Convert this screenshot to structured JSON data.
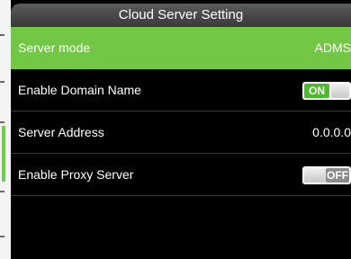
{
  "window": {
    "title": "Cloud Server Setting"
  },
  "settings": [
    {
      "label": "Server mode",
      "value": "ADMS",
      "type": "value",
      "selected": true
    },
    {
      "label": "Enable Domain Name",
      "value": "ON",
      "type": "toggle",
      "state": "on"
    },
    {
      "label": "Server Address",
      "value": "0.0.0.0",
      "type": "value"
    },
    {
      "label": "Enable Proxy Server",
      "value": "OFF",
      "type": "toggle",
      "state": "off"
    }
  ],
  "colors": {
    "selected_row": "#72c845",
    "toggle_on": "#4fb82e",
    "toggle_off": "#8c8c8c",
    "background": "#000000"
  }
}
